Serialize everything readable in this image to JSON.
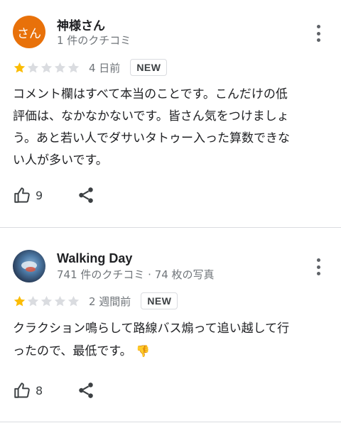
{
  "reviews": [
    {
      "reviewer_name": "神様さん",
      "avatar_initial": "さん",
      "avatar_color": "#e8710a",
      "reviewer_stats": "1 件のクチコミ",
      "rating": 1,
      "max_rating": 5,
      "time_ago": "4 日前",
      "badge": "NEW",
      "text_lines": [
        "コメント欄はすべて本当のことです。こんだけの低",
        "評価は、なかなかないです。皆さん気をつけましょ",
        "う。あと若い人でダサいタトゥー入った算数できな",
        "い人が多いです。"
      ],
      "likes": "9"
    },
    {
      "reviewer_name": "Walking Day",
      "reviewer_stats": "741 件のクチコミ · 74 枚の写真",
      "rating": 1,
      "max_rating": 5,
      "time_ago": "2 週間前",
      "badge": "NEW",
      "text_lines": [
        "クラクション鳴らして路線バス煽って追い越して行",
        "ったので、最低です。"
      ],
      "emoji": "👎",
      "likes": "8"
    }
  ],
  "colors": {
    "star_filled": "#fbbc04",
    "star_empty": "#dadce0",
    "icon": "#5f6368"
  },
  "icons": {
    "menu": "more-vert-icon",
    "like": "thumb-up-icon",
    "share": "share-icon",
    "star": "star-icon"
  }
}
